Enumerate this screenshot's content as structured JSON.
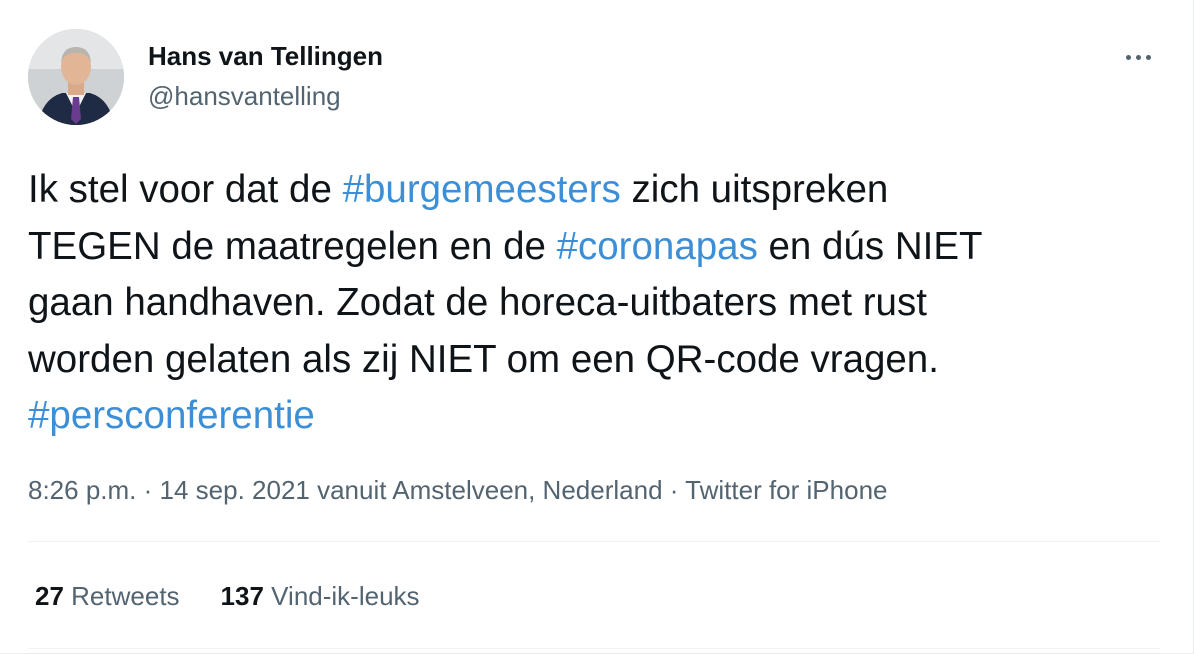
{
  "user": {
    "name": "Hans van Tellingen",
    "handle": "@hansvantelling"
  },
  "tweet": {
    "lines": [
      [
        {
          "t": "Ik stel voor dat de "
        },
        {
          "t": "#burgemeesters",
          "tag": true
        },
        {
          "t": " zich uitspreken"
        }
      ],
      [
        {
          "t": "TEGEN de maatregelen en de "
        },
        {
          "t": "#coronapas",
          "tag": true
        },
        {
          "t": " en dús NIET"
        }
      ],
      [
        {
          "t": "gaan handhaven. Zodat de horeca-uitbaters met rust"
        }
      ],
      [
        {
          "t": "worden gelaten als zij NIET om een QR-code vragen."
        }
      ],
      [
        {
          "t": "#persconferentie",
          "tag": true
        }
      ]
    ]
  },
  "meta": {
    "time": "8:26 p.m.",
    "sep1": " · ",
    "date": "14 sep. 2021",
    "location": " vanuit Amstelveen, Nederland",
    "sep2": " · ",
    "source": "Twitter for iPhone"
  },
  "stats": {
    "retweets_count": "27",
    "retweets_label": "Retweets",
    "likes_count": "137",
    "likes_label": "Vind-ik-leuks"
  },
  "colors": {
    "link": "#3c8fd6",
    "secondary_text": "#536471",
    "primary_text": "#0f1419"
  },
  "icons": {
    "more": "more-horizontal-icon"
  }
}
